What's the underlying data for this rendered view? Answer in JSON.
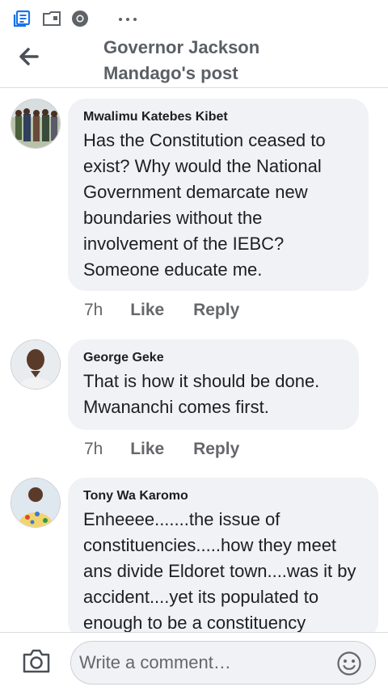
{
  "header": {
    "title": "Governor Jackson Mandago's post"
  },
  "comments": [
    {
      "author": "Mwalimu Katebes Kibet",
      "text": "Has the Constitution ceased to exist? Why would the National Government demarcate new boundaries without the involvement of the IEBC? Someone educate me.",
      "time": "7h",
      "like_label": "Like",
      "reply_label": "Reply"
    },
    {
      "author": "George Geke",
      "text": "That is how it should be done. Mwananchi comes first.",
      "time": "7h",
      "like_label": "Like",
      "reply_label": "Reply"
    },
    {
      "author": "Tony Wa Karomo",
      "text": "Enheeee.......the issue of constituencies.....how they meet ans divide Eldoret town....was it by accident....yet its populated to enough to be a constituency"
    }
  ],
  "composer": {
    "placeholder": "Write a comment…"
  },
  "icons": {
    "status_bar": [
      "news-icon",
      "folder-icon",
      "chrome-icon",
      "more-dots-icon"
    ],
    "back": "back-arrow-icon",
    "camera": "camera-icon",
    "emoji": "smiley-icon"
  },
  "colors": {
    "accent": "#1877f2",
    "bubble": "#f0f2f5",
    "secondary_text": "#65676b"
  }
}
